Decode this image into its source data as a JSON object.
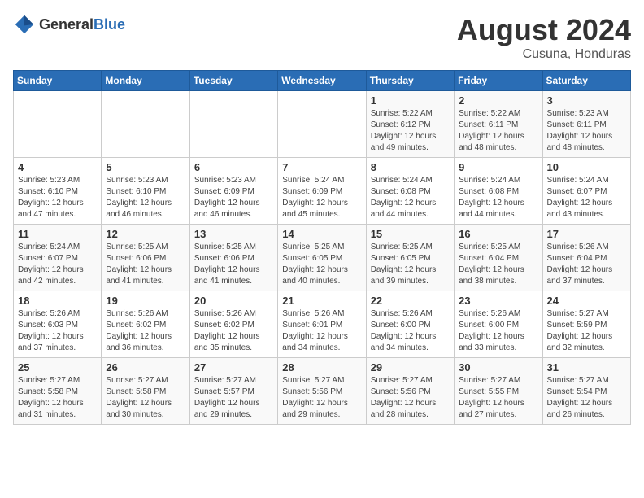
{
  "header": {
    "logo": {
      "general": "General",
      "blue": "Blue"
    },
    "title": "August 2024",
    "location": "Cusuna, Honduras"
  },
  "weekdays": [
    "Sunday",
    "Monday",
    "Tuesday",
    "Wednesday",
    "Thursday",
    "Friday",
    "Saturday"
  ],
  "weeks": [
    [
      {
        "day": "",
        "detail": ""
      },
      {
        "day": "",
        "detail": ""
      },
      {
        "day": "",
        "detail": ""
      },
      {
        "day": "",
        "detail": ""
      },
      {
        "day": "1",
        "detail": "Sunrise: 5:22 AM\nSunset: 6:12 PM\nDaylight: 12 hours\nand 49 minutes."
      },
      {
        "day": "2",
        "detail": "Sunrise: 5:22 AM\nSunset: 6:11 PM\nDaylight: 12 hours\nand 48 minutes."
      },
      {
        "day": "3",
        "detail": "Sunrise: 5:23 AM\nSunset: 6:11 PM\nDaylight: 12 hours\nand 48 minutes."
      }
    ],
    [
      {
        "day": "4",
        "detail": "Sunrise: 5:23 AM\nSunset: 6:10 PM\nDaylight: 12 hours\nand 47 minutes."
      },
      {
        "day": "5",
        "detail": "Sunrise: 5:23 AM\nSunset: 6:10 PM\nDaylight: 12 hours\nand 46 minutes."
      },
      {
        "day": "6",
        "detail": "Sunrise: 5:23 AM\nSunset: 6:09 PM\nDaylight: 12 hours\nand 46 minutes."
      },
      {
        "day": "7",
        "detail": "Sunrise: 5:24 AM\nSunset: 6:09 PM\nDaylight: 12 hours\nand 45 minutes."
      },
      {
        "day": "8",
        "detail": "Sunrise: 5:24 AM\nSunset: 6:08 PM\nDaylight: 12 hours\nand 44 minutes."
      },
      {
        "day": "9",
        "detail": "Sunrise: 5:24 AM\nSunset: 6:08 PM\nDaylight: 12 hours\nand 44 minutes."
      },
      {
        "day": "10",
        "detail": "Sunrise: 5:24 AM\nSunset: 6:07 PM\nDaylight: 12 hours\nand 43 minutes."
      }
    ],
    [
      {
        "day": "11",
        "detail": "Sunrise: 5:24 AM\nSunset: 6:07 PM\nDaylight: 12 hours\nand 42 minutes."
      },
      {
        "day": "12",
        "detail": "Sunrise: 5:25 AM\nSunset: 6:06 PM\nDaylight: 12 hours\nand 41 minutes."
      },
      {
        "day": "13",
        "detail": "Sunrise: 5:25 AM\nSunset: 6:06 PM\nDaylight: 12 hours\nand 41 minutes."
      },
      {
        "day": "14",
        "detail": "Sunrise: 5:25 AM\nSunset: 6:05 PM\nDaylight: 12 hours\nand 40 minutes."
      },
      {
        "day": "15",
        "detail": "Sunrise: 5:25 AM\nSunset: 6:05 PM\nDaylight: 12 hours\nand 39 minutes."
      },
      {
        "day": "16",
        "detail": "Sunrise: 5:25 AM\nSunset: 6:04 PM\nDaylight: 12 hours\nand 38 minutes."
      },
      {
        "day": "17",
        "detail": "Sunrise: 5:26 AM\nSunset: 6:04 PM\nDaylight: 12 hours\nand 37 minutes."
      }
    ],
    [
      {
        "day": "18",
        "detail": "Sunrise: 5:26 AM\nSunset: 6:03 PM\nDaylight: 12 hours\nand 37 minutes."
      },
      {
        "day": "19",
        "detail": "Sunrise: 5:26 AM\nSunset: 6:02 PM\nDaylight: 12 hours\nand 36 minutes."
      },
      {
        "day": "20",
        "detail": "Sunrise: 5:26 AM\nSunset: 6:02 PM\nDaylight: 12 hours\nand 35 minutes."
      },
      {
        "day": "21",
        "detail": "Sunrise: 5:26 AM\nSunset: 6:01 PM\nDaylight: 12 hours\nand 34 minutes."
      },
      {
        "day": "22",
        "detail": "Sunrise: 5:26 AM\nSunset: 6:00 PM\nDaylight: 12 hours\nand 34 minutes."
      },
      {
        "day": "23",
        "detail": "Sunrise: 5:26 AM\nSunset: 6:00 PM\nDaylight: 12 hours\nand 33 minutes."
      },
      {
        "day": "24",
        "detail": "Sunrise: 5:27 AM\nSunset: 5:59 PM\nDaylight: 12 hours\nand 32 minutes."
      }
    ],
    [
      {
        "day": "25",
        "detail": "Sunrise: 5:27 AM\nSunset: 5:58 PM\nDaylight: 12 hours\nand 31 minutes."
      },
      {
        "day": "26",
        "detail": "Sunrise: 5:27 AM\nSunset: 5:58 PM\nDaylight: 12 hours\nand 30 minutes."
      },
      {
        "day": "27",
        "detail": "Sunrise: 5:27 AM\nSunset: 5:57 PM\nDaylight: 12 hours\nand 29 minutes."
      },
      {
        "day": "28",
        "detail": "Sunrise: 5:27 AM\nSunset: 5:56 PM\nDaylight: 12 hours\nand 29 minutes."
      },
      {
        "day": "29",
        "detail": "Sunrise: 5:27 AM\nSunset: 5:56 PM\nDaylight: 12 hours\nand 28 minutes."
      },
      {
        "day": "30",
        "detail": "Sunrise: 5:27 AM\nSunset: 5:55 PM\nDaylight: 12 hours\nand 27 minutes."
      },
      {
        "day": "31",
        "detail": "Sunrise: 5:27 AM\nSunset: 5:54 PM\nDaylight: 12 hours\nand 26 minutes."
      }
    ]
  ]
}
